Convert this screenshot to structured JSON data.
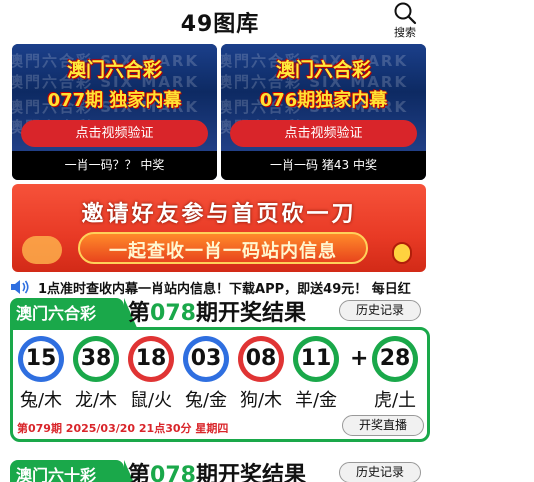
{
  "header": {
    "title": "49图库",
    "search_label": "搜索"
  },
  "cards": [
    {
      "watermark": "澳門六合彩 SIX MARK",
      "title": "澳门六合彩",
      "subtitle": "077期 独家内幕",
      "button": "点击视频验证",
      "caption": "一肖一码？？ 中奖"
    },
    {
      "watermark": "澳門六合彩 SIX MARK",
      "title": "澳门六合彩",
      "subtitle": "076期独家内幕",
      "button": "点击视频验证",
      "caption": "一肖一码 猪43 中奖"
    }
  ],
  "banner": {
    "line1": "邀请好友参与首页砍一刀",
    "line2": "一起查收一肖一码站内信息"
  },
  "notice": {
    "text": "1点准时查收内幕一肖站内信息！下载APP，即送49元！ 每日红"
  },
  "results": [
    {
      "tab": "澳门六合彩",
      "heading_pre": "第",
      "issue": "078",
      "heading_post": "期开奖结果",
      "history_button": "历史记录",
      "balls": [
        {
          "num": "15",
          "color": "blue",
          "zodiac": "兔/木"
        },
        {
          "num": "38",
          "color": "green",
          "zodiac": "龙/木"
        },
        {
          "num": "18",
          "color": "red",
          "zodiac": "鼠/火"
        },
        {
          "num": "03",
          "color": "blue",
          "zodiac": "兔/金"
        },
        {
          "num": "08",
          "color": "red",
          "zodiac": "狗/木"
        },
        {
          "num": "11",
          "color": "green",
          "zodiac": "羊/金"
        }
      ],
      "plus": "+",
      "special": {
        "num": "28",
        "color": "green",
        "zodiac": "虎/土"
      },
      "next_draw": "第079期 2025/03/20 21点30分 星期四",
      "live_button": "开奖直播"
    },
    {
      "tab": "澳门六十彩",
      "heading_pre": "第",
      "issue": "078",
      "heading_post": "期开奖结果",
      "history_button": "历史记录"
    }
  ],
  "colors": {
    "green": "#1aa84a",
    "blue": "#2f6fe0",
    "red": "#e03434",
    "accent_red": "#d9252a"
  }
}
